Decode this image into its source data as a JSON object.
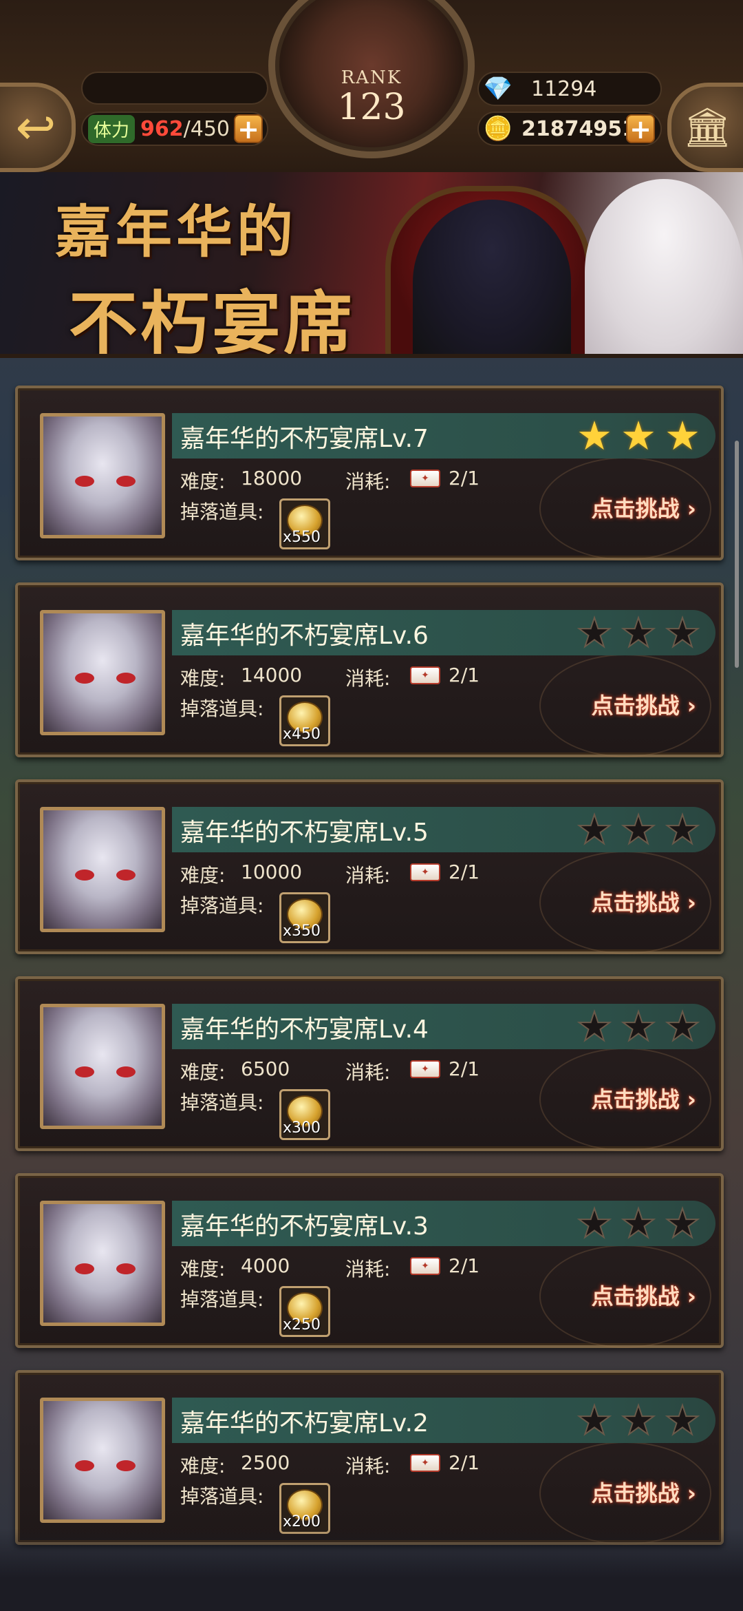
{
  "header": {
    "rank_label": "RANK",
    "rank_value": "123",
    "stamina_label": "体力",
    "stamina_current": "962",
    "stamina_sep": "/",
    "stamina_max": "450",
    "gems": "11294",
    "gold": "21874951",
    "back_icon": "back-arrow-icon",
    "home_icon": "bank-icon"
  },
  "banner": {
    "line1": "嘉年华的",
    "line2": "不朽宴席"
  },
  "labels": {
    "difficulty": "难度:",
    "cost": "消耗:",
    "drops": "掉落道具:",
    "challenge": "点击挑战 ›"
  },
  "stages": [
    {
      "title": "嘉年华的不朽宴席Lv.7",
      "difficulty": "18000",
      "cost": "2/1",
      "drop_count": "x550",
      "stars": 3
    },
    {
      "title": "嘉年华的不朽宴席Lv.6",
      "difficulty": "14000",
      "cost": "2/1",
      "drop_count": "x450",
      "stars": 0
    },
    {
      "title": "嘉年华的不朽宴席Lv.5",
      "difficulty": "10000",
      "cost": "2/1",
      "drop_count": "x350",
      "stars": 0
    },
    {
      "title": "嘉年华的不朽宴席Lv.4",
      "difficulty": "6500",
      "cost": "2/1",
      "drop_count": "x300",
      "stars": 0
    },
    {
      "title": "嘉年华的不朽宴席Lv.3",
      "difficulty": "4000",
      "cost": "2/1",
      "drop_count": "x250",
      "stars": 0
    },
    {
      "title": "嘉年华的不朽宴席Lv.2",
      "difficulty": "2500",
      "cost": "2/1",
      "drop_count": "x200",
      "stars": 0
    }
  ],
  "colors": {
    "star_on": "#ffd23a",
    "title_strip": "#2f5a52",
    "frame": "#7a6446"
  }
}
